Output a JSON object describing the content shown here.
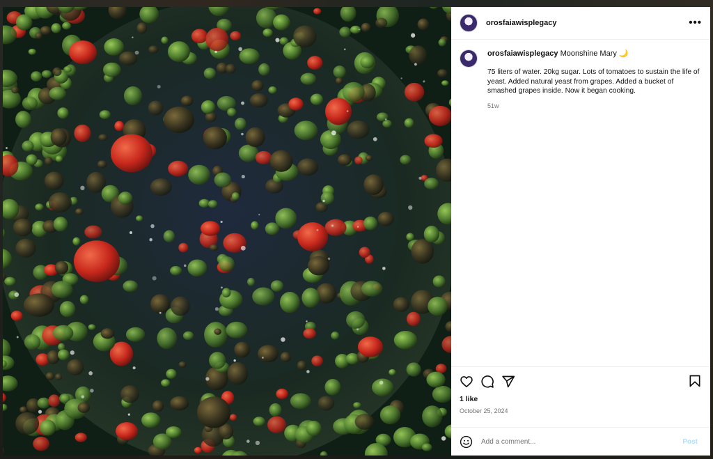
{
  "post": {
    "author": "orosfaiawisplegacy",
    "more_icon": "more-horizontal-icon",
    "caption": {
      "title": "Moonshine Mary 🌙",
      "text": "75 liters of water. 20kg sugar. Lots of tomatoes to sustain the life of yeast. Added natural yeast from grapes. Added a bucket of smashed grapes inside. Now it began cooking.",
      "age": "51w"
    },
    "likes": "1 like",
    "date": "October 25, 2024"
  },
  "actions": {
    "like_icon": "heart-icon",
    "comment_icon": "comment-icon",
    "share_icon": "share-icon",
    "save_icon": "bookmark-icon"
  },
  "comment_box": {
    "placeholder": "Add a comment...",
    "post_label": "Post",
    "emoji_icon": "emoji-icon"
  },
  "colors": {
    "post_disabled": "#b2dffc",
    "muted": "#737373",
    "text": "#111111"
  }
}
